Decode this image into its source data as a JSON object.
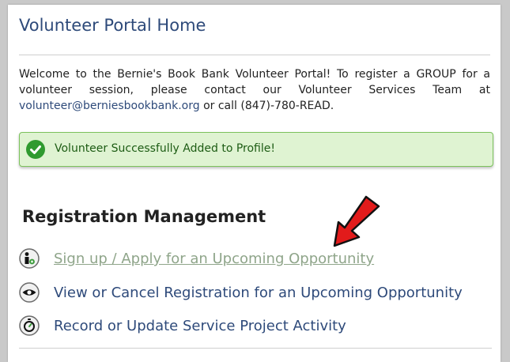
{
  "page": {
    "title": "Volunteer Portal Home"
  },
  "welcome": {
    "text_before": "Welcome to the Bernie's Book Bank Volunteer Portal! To register a GROUP for a volunteer session, please contact our Volunteer Services Team at ",
    "email": "volunteer@berniesbookbank.org",
    "text_after": " or call (847)-780-READ."
  },
  "alert": {
    "message": "Volunteer Successfully Added to Profile!",
    "icon": "check-circle-icon",
    "color": "#2f9a2f"
  },
  "registration": {
    "title": "Registration Management",
    "items": [
      {
        "label": "Sign up / Apply for an Upcoming Opportunity",
        "icon": "person-plus-icon"
      },
      {
        "label": "View or Cancel Registration for an Upcoming Opportunity",
        "icon": "eye-icon"
      },
      {
        "label": "Record or Update Service Project Activity",
        "icon": "stopwatch-icon"
      }
    ]
  },
  "annotation": {
    "arrow_color": "#e21b1b"
  }
}
